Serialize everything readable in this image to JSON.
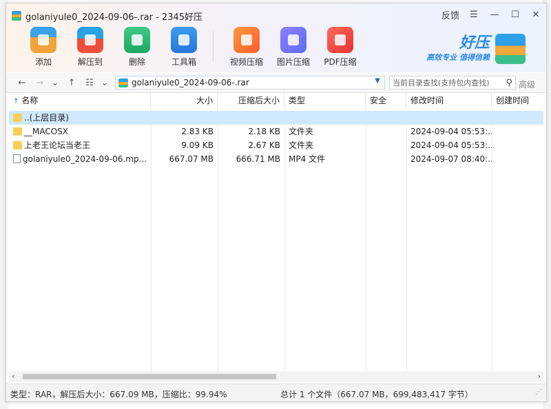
{
  "window": {
    "title": "golaniyule0_2024-09-06-.rar - 2345好压",
    "feedback_label": "反馈"
  },
  "toolbar": {
    "tools": [
      {
        "label": "添加",
        "icon": "add-archive-icon"
      },
      {
        "label": "解压到",
        "icon": "extract-icon"
      },
      {
        "label": "删除",
        "icon": "delete-recycle-icon"
      },
      {
        "label": "工具箱",
        "icon": "toolbox-icon"
      },
      {
        "label": "视频压缩",
        "icon": "video-compress-icon"
      },
      {
        "label": "图片压缩",
        "icon": "image-compress-icon"
      },
      {
        "label": "PDF压缩",
        "icon": "pdf-compress-icon"
      }
    ],
    "brand_name": "好压",
    "brand_slogan": "高效专业 值得信赖"
  },
  "navbar": {
    "path": "golaniyule0_2024-09-06-.rar",
    "search_placeholder": "当前目录查找(支持包内查找)",
    "advanced_label": "高级"
  },
  "columns": {
    "name": "名称",
    "size": "大小",
    "packed": "压缩后大小",
    "type": "类型",
    "security": "安全",
    "modified": "修改时间",
    "created": "创建时间"
  },
  "files": [
    {
      "name": "..(上层目录)",
      "size": "",
      "packed": "",
      "type": "",
      "modified": "",
      "kind": "folder",
      "selected": true
    },
    {
      "name": "__MACOSX",
      "size": "2.83 KB",
      "packed": "2.18 KB",
      "type": "文件夹",
      "modified": "2024-09-04 05:53:...",
      "kind": "folder",
      "selected": false
    },
    {
      "name": "上老王论坛当老王",
      "size": "9.09 KB",
      "packed": "2.67 KB",
      "type": "文件夹",
      "modified": "2024-09-04 05:53:...",
      "kind": "folder",
      "selected": false
    },
    {
      "name": "golaniyule0_2024-09-06.mp...",
      "size": "667.07 MB",
      "packed": "666.71 MB",
      "type": "MP4 文件",
      "modified": "2024-09-07 08:40:...",
      "kind": "mp4",
      "selected": false
    }
  ],
  "status": {
    "left": "类型：RAR，解压后大小：667.09 MB，压缩比：99.94%",
    "right": "总计 1 个文件（667.07 MB，699,483,417 字节）"
  }
}
